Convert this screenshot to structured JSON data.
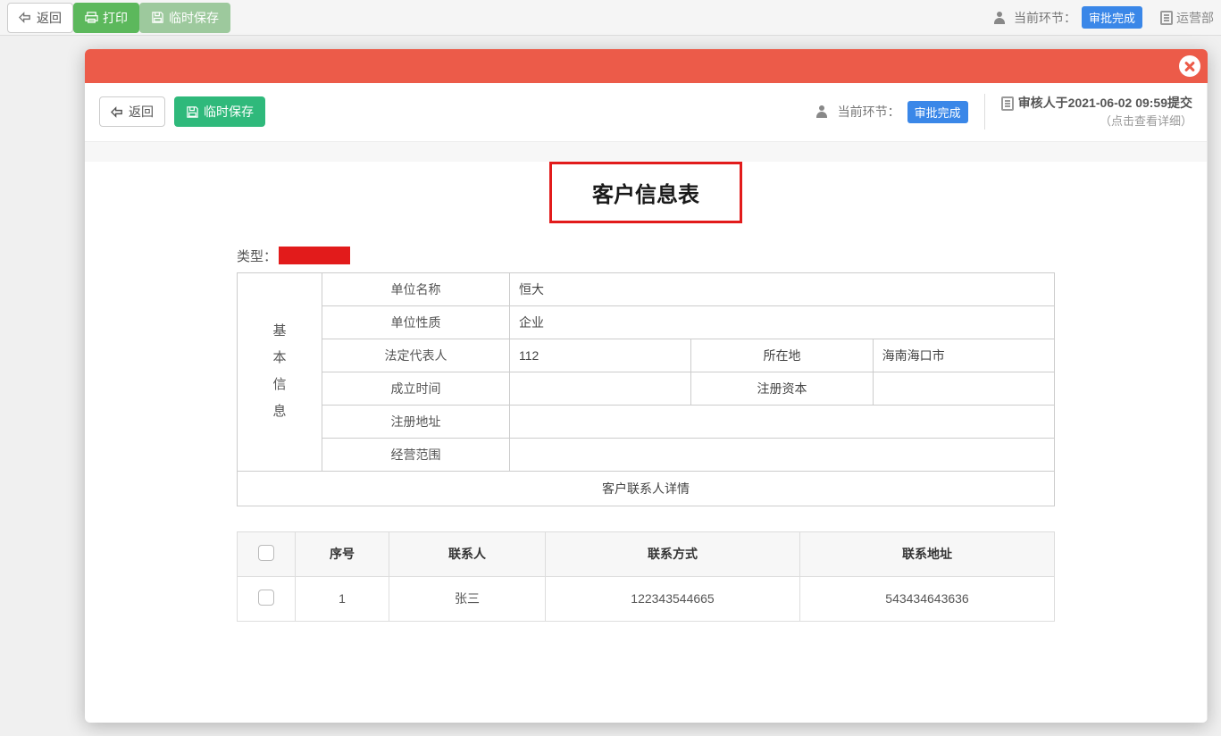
{
  "bg_toolbar": {
    "back_label": "返回",
    "print_label": "打印",
    "tempsave_label": "临时保存",
    "stage_label": "当前环节：",
    "stage_badge": "审批完成",
    "ops_label": "运营部"
  },
  "modal": {
    "toolbar": {
      "back_label": "返回",
      "tempsave_label": "临时保存",
      "stage_label": "当前环节：",
      "stage_badge": "审批完成",
      "submit_text": "审核人于2021-06-02 09:59提交",
      "submit_hint": "（点击查看详细）"
    },
    "title": "客户信息表",
    "type_label": "类型：",
    "basic_info": {
      "section_label": "基\n本\n信\n息",
      "fields": {
        "org_name_label": "单位名称",
        "org_name_value": "恒大",
        "org_nature_label": "单位性质",
        "org_nature_value": "企业",
        "legal_rep_label": "法定代表人",
        "legal_rep_value": "112",
        "location_label": "所在地",
        "location_value": "海南海口市",
        "founded_label": "成立时间",
        "founded_value": "",
        "capital_label": "注册资本",
        "capital_value": "",
        "address_label": "注册地址",
        "address_value": "",
        "scope_label": "经营范围",
        "scope_value": ""
      },
      "contacts_header": "客户联系人详情"
    },
    "contacts_table": {
      "headers": {
        "num": "序号",
        "name": "联系人",
        "phone": "联系方式",
        "addr": "联系地址"
      },
      "rows": [
        {
          "num": "1",
          "name": "张三",
          "phone": "122343544665",
          "addr": "543434643636"
        }
      ]
    }
  }
}
